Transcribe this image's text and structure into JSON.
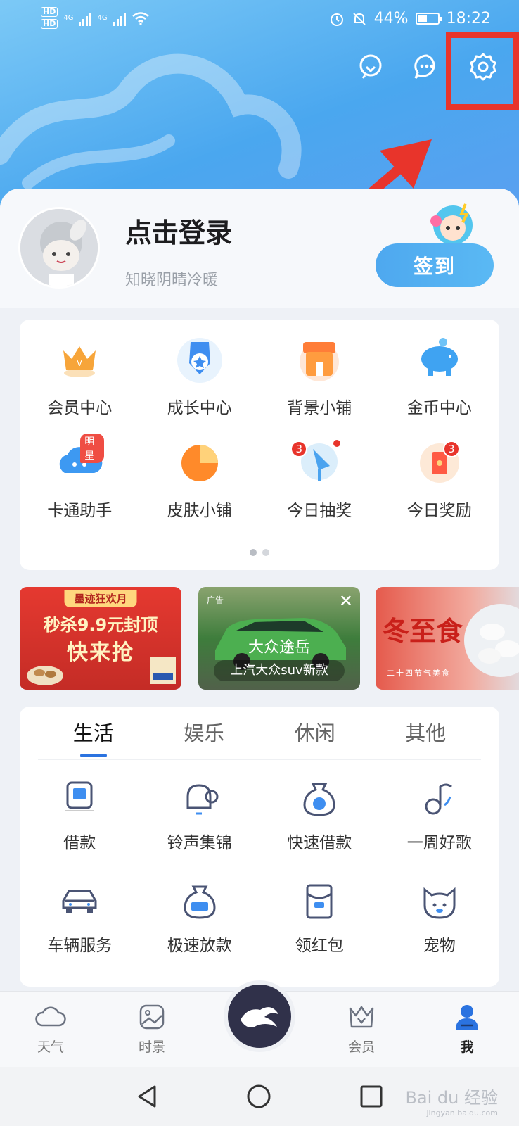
{
  "status_bar": {
    "network_left": "4G",
    "network_right": "4G",
    "hd1": "HD",
    "hd2": "HD",
    "battery": "44%",
    "time": "18:22"
  },
  "header": {
    "icons": [
      "lightbulb-icon",
      "chat-icon",
      "settings-icon"
    ]
  },
  "profile": {
    "login_title": "点击登录",
    "subtitle": "知晓阴晴冷暖",
    "checkin_label": "签到"
  },
  "services": {
    "items": [
      {
        "label": "会员中心",
        "icon": "crown-icon"
      },
      {
        "label": "成长中心",
        "icon": "medal-icon"
      },
      {
        "label": "背景小铺",
        "icon": "shop-icon"
      },
      {
        "label": "金币中心",
        "icon": "piggy-bank-icon"
      },
      {
        "label": "卡通助手",
        "icon": "cartoon-cloud-icon",
        "tag": "明星"
      },
      {
        "label": "皮肤小铺",
        "icon": "pie-icon"
      },
      {
        "label": "今日抽奖",
        "icon": "lottery-icon",
        "badge": "3"
      },
      {
        "label": "今日奖励",
        "icon": "red-envelope-icon",
        "badge": "3"
      }
    ]
  },
  "banners": {
    "b1_top": "墨迹狂欢月",
    "b1_line1": "秒杀9.9元封顶",
    "b1_line2": "快来抢",
    "b2_ad": "广告",
    "b2_title": "大众途岳",
    "b2_sub": "上汽大众suv新款",
    "b3_title": "冬至食",
    "b3_sub": "二十四节气美食"
  },
  "categories": {
    "tabs": [
      "生活",
      "娱乐",
      "休闲",
      "其他"
    ],
    "items": [
      {
        "label": "借款",
        "icon": "loan-icon"
      },
      {
        "label": "铃声集锦",
        "icon": "bell-icon"
      },
      {
        "label": "快速借款",
        "icon": "money-bag-icon"
      },
      {
        "label": "一周好歌",
        "icon": "music-note-icon"
      },
      {
        "label": "车辆服务",
        "icon": "car-icon"
      },
      {
        "label": "极速放款",
        "icon": "fast-loan-icon"
      },
      {
        "label": "领红包",
        "icon": "red-packet-icon"
      },
      {
        "label": "宠物",
        "icon": "pet-icon"
      }
    ]
  },
  "bottom_nav": {
    "items": [
      "天气",
      "时景",
      "会员",
      "我"
    ]
  },
  "watermark": {
    "text": "Bai du 经验",
    "sub": "jingyan.baidu.com"
  },
  "colors": {
    "accent": "#2b73e0",
    "highlight": "#e8342b",
    "header_blue": "#4aa7ef"
  }
}
